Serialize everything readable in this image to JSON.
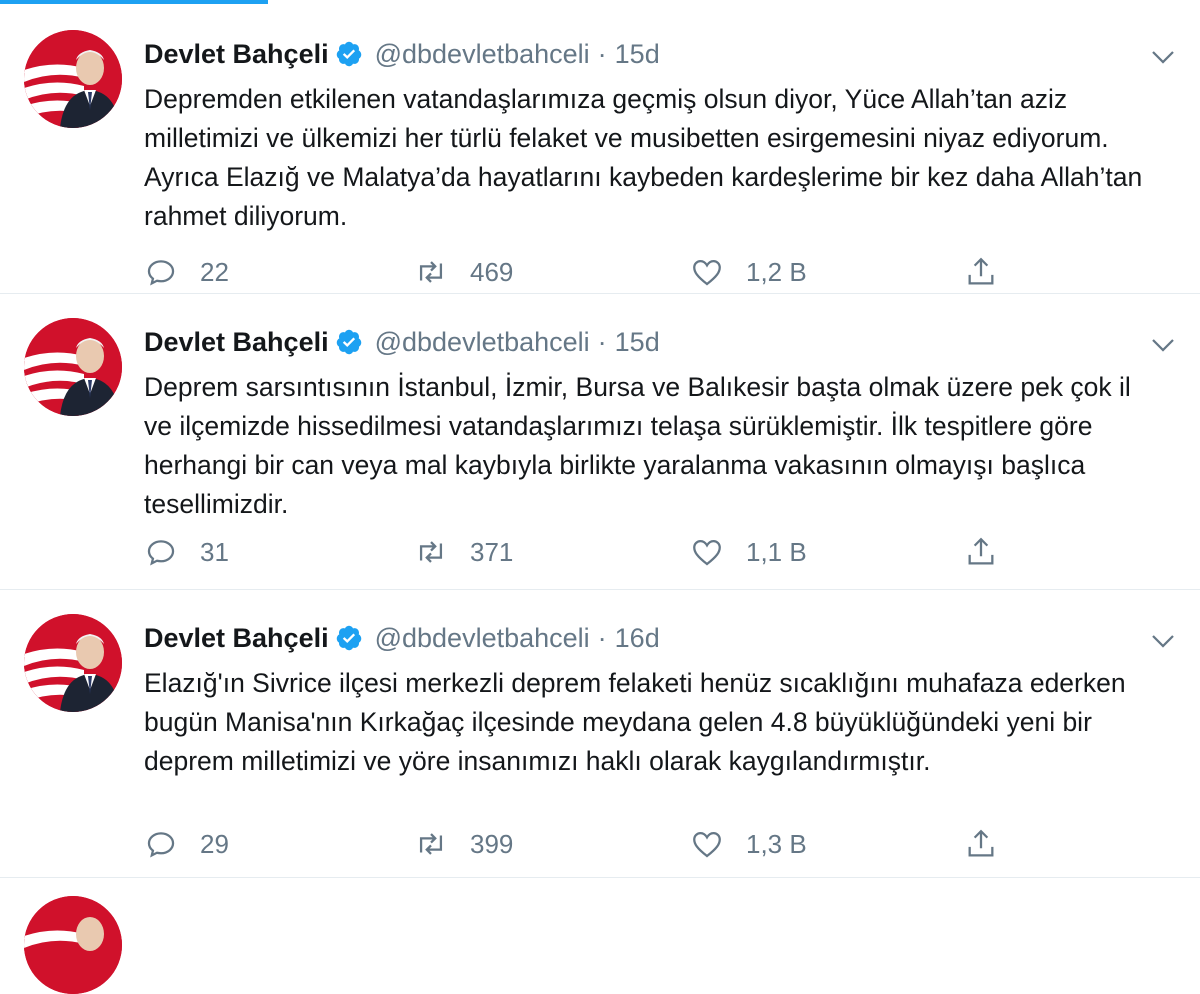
{
  "colors": {
    "accent": "#1da1f2",
    "text": "#14171a",
    "muted": "#657786"
  },
  "tweets": [
    {
      "name": "Devlet Bahçeli",
      "handle": "@dbdevletbahceli",
      "separator": "·",
      "time": "15d",
      "text": "Depremden etkilenen vatandaşlarımıza geçmiş olsun diyor, Yüce Allah’tan aziz milletimizi ve ülkemizi her türlü felaket ve musibetten esirgemesini niyaz ediyorum. Ayrıca Elazığ ve Malatya’da hayatlarını kaybeden kardeşlerime bir kez daha Allah’tan rahmet diliyorum.",
      "replies": "22",
      "retweets": "469",
      "likes": "1,2 B"
    },
    {
      "name": "Devlet Bahçeli",
      "handle": "@dbdevletbahceli",
      "separator": "·",
      "time": "15d",
      "text": "Deprem sarsıntısının İstanbul, İzmir, Bursa ve Balıkesir başta olmak üzere pek çok il ve ilçemizde hissedilmesi vatandaşlarımızı telaşa sürüklemiştir. İlk tespitlere göre herhangi bir can veya mal kaybıyla birlikte yaralanma vakasının olmayışı başlıca tesellimizdir.",
      "replies": "31",
      "retweets": "371",
      "likes": "1,1 B"
    },
    {
      "name": "Devlet Bahçeli",
      "handle": "@dbdevletbahceli",
      "separator": "·",
      "time": "16d",
      "text": "Elazığ'ın Sivrice ilçesi merkezli deprem felaketi henüz sıcaklığını muhafaza ederken bugün Manisa'nın Kırkağaç ilçesinde meydana gelen 4.8 büyüklüğündeki yeni bir deprem milletimizi ve yöre insanımızı haklı olarak kaygılandırmıştır.",
      "replies": "29",
      "retweets": "399",
      "likes": "1,3 B"
    }
  ],
  "icons": {
    "verified": "verified-badge-icon",
    "caret": "chevron-down-icon",
    "reply": "reply-icon",
    "retweet": "retweet-icon",
    "like": "heart-icon",
    "share": "share-icon"
  }
}
